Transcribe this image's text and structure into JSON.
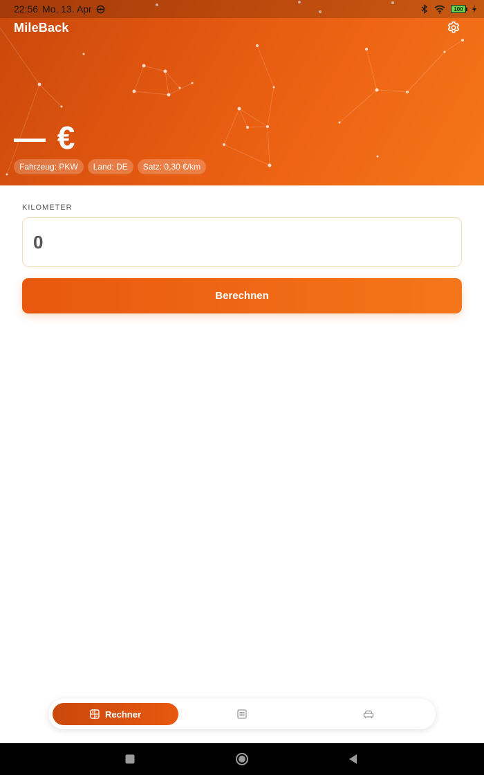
{
  "status_bar": {
    "time": "22:56",
    "date": "Mo, 13. Apr",
    "battery": "100"
  },
  "app": {
    "title": "MileBack"
  },
  "summary": {
    "amount": "— €",
    "chips": [
      "Fahrzeug: PKW",
      "Land: DE",
      "Satz: 0,30 €/km"
    ]
  },
  "form": {
    "km_label": "KILOMETER",
    "km_value": "0",
    "calc_label": "Berechnen"
  },
  "bottom_nav": {
    "active_label": "Rechner",
    "items": [
      "calculator-icon",
      "list-icon",
      "car-icon"
    ]
  },
  "colors": {
    "accent": "#ee6414",
    "accent_dark": "#c9480c",
    "input_border": "#f5dcb8"
  }
}
